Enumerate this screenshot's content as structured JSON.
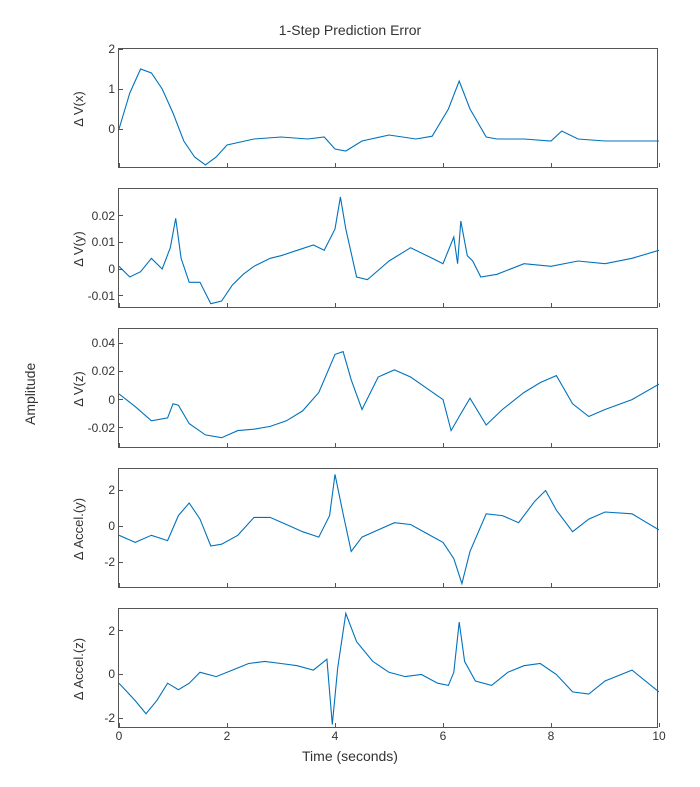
{
  "chart_data": [
    {
      "type": "line",
      "title": "1-Step Prediction Error",
      "xlabel": "",
      "ylabel": "Δ V(x)",
      "xlim": [
        0,
        10
      ],
      "ylim": [
        -1,
        2
      ],
      "yticks": [
        0,
        1,
        2
      ],
      "x": [
        0,
        0.2,
        0.4,
        0.6,
        0.8,
        1.0,
        1.2,
        1.4,
        1.6,
        1.8,
        2.0,
        2.5,
        3.0,
        3.5,
        3.8,
        4.0,
        4.2,
        4.5,
        5.0,
        5.5,
        5.8,
        6.1,
        6.3,
        6.5,
        6.8,
        7.0,
        7.5,
        8.0,
        8.2,
        8.5,
        9.0,
        9.5,
        10.0
      ],
      "values": [
        0.0,
        0.9,
        1.5,
        1.4,
        1.0,
        0.4,
        -0.3,
        -0.7,
        -0.9,
        -0.7,
        -0.4,
        -0.25,
        -0.2,
        -0.25,
        -0.2,
        -0.5,
        -0.55,
        -0.3,
        -0.15,
        -0.25,
        -0.18,
        0.5,
        1.2,
        0.5,
        -0.2,
        -0.25,
        -0.25,
        -0.3,
        -0.05,
        -0.25,
        -0.3,
        -0.3,
        -0.3
      ]
    },
    {
      "type": "line",
      "xlabel": "",
      "ylabel": "Δ V(y)",
      "xlim": [
        0,
        10
      ],
      "ylim": [
        -0.015,
        0.03
      ],
      "yticks": [
        -0.01,
        0,
        0.01,
        0.02
      ],
      "x": [
        0,
        0.2,
        0.4,
        0.6,
        0.8,
        0.95,
        1.05,
        1.15,
        1.3,
        1.5,
        1.7,
        1.9,
        2.1,
        2.3,
        2.5,
        2.8,
        3.0,
        3.3,
        3.6,
        3.8,
        4.0,
        4.1,
        4.2,
        4.4,
        4.6,
        5.0,
        5.4,
        5.8,
        6.0,
        6.2,
        6.27,
        6.33,
        6.45,
        6.55,
        6.7,
        7.0,
        7.5,
        8.0,
        8.5,
        9.0,
        9.5,
        10.0
      ],
      "values": [
        0.001,
        -0.003,
        -0.001,
        0.004,
        0.0,
        0.008,
        0.019,
        0.004,
        -0.005,
        -0.005,
        -0.013,
        -0.012,
        -0.006,
        -0.002,
        0.001,
        0.004,
        0.005,
        0.007,
        0.009,
        0.007,
        0.015,
        0.027,
        0.015,
        -0.003,
        -0.004,
        0.003,
        0.008,
        0.004,
        0.002,
        0.012,
        0.002,
        0.018,
        0.005,
        0.003,
        -0.003,
        -0.002,
        0.002,
        0.001,
        0.003,
        0.002,
        0.004,
        0.007
      ]
    },
    {
      "type": "line",
      "xlabel": "",
      "ylabel": "Δ V(z)",
      "xlim": [
        0,
        10
      ],
      "ylim": [
        -0.035,
        0.05
      ],
      "yticks": [
        -0.02,
        0,
        0.02,
        0.04
      ],
      "x": [
        0,
        0.3,
        0.6,
        0.9,
        1.0,
        1.1,
        1.3,
        1.6,
        1.9,
        2.2,
        2.5,
        2.8,
        3.1,
        3.4,
        3.7,
        4.0,
        4.15,
        4.3,
        4.5,
        4.8,
        5.1,
        5.4,
        5.7,
        6.0,
        6.15,
        6.3,
        6.5,
        6.8,
        7.1,
        7.5,
        7.8,
        8.1,
        8.4,
        8.7,
        9.0,
        9.5,
        10.0
      ],
      "values": [
        0.004,
        -0.005,
        -0.015,
        -0.013,
        -0.003,
        -0.004,
        -0.017,
        -0.025,
        -0.027,
        -0.022,
        -0.021,
        -0.019,
        -0.015,
        -0.008,
        0.005,
        0.032,
        0.034,
        0.014,
        -0.007,
        0.016,
        0.021,
        0.016,
        0.008,
        0.0,
        -0.022,
        -0.012,
        0.001,
        -0.018,
        -0.007,
        0.005,
        0.012,
        0.017,
        -0.003,
        -0.012,
        -0.007,
        0.0,
        0.011
      ]
    },
    {
      "type": "line",
      "xlabel": "",
      "ylabel": "Δ Accel.(y)",
      "xlim": [
        0,
        10
      ],
      "ylim": [
        -3.5,
        3.2
      ],
      "yticks": [
        -2,
        0,
        2
      ],
      "x": [
        0,
        0.3,
        0.6,
        0.9,
        1.1,
        1.3,
        1.5,
        1.7,
        1.9,
        2.2,
        2.5,
        2.8,
        3.1,
        3.4,
        3.7,
        3.9,
        4.0,
        4.15,
        4.3,
        4.5,
        4.8,
        5.1,
        5.4,
        5.7,
        6.0,
        6.2,
        6.35,
        6.5,
        6.8,
        7.1,
        7.4,
        7.7,
        7.9,
        8.1,
        8.4,
        8.7,
        9.0,
        9.5,
        10.0
      ],
      "values": [
        -0.5,
        -0.9,
        -0.5,
        -0.8,
        0.6,
        1.3,
        0.4,
        -1.1,
        -1.0,
        -0.5,
        0.5,
        0.5,
        0.1,
        -0.3,
        -0.6,
        0.6,
        2.9,
        0.7,
        -1.4,
        -0.6,
        -0.2,
        0.2,
        0.1,
        -0.4,
        -0.9,
        -1.8,
        -3.2,
        -1.4,
        0.7,
        0.6,
        0.2,
        1.4,
        2.0,
        0.9,
        -0.3,
        0.4,
        0.8,
        0.7,
        -0.2
      ]
    },
    {
      "type": "line",
      "xlabel": "Time (seconds)",
      "ylabel": "Δ Accel.(z)",
      "xlim": [
        0,
        10
      ],
      "ylim": [
        -2.5,
        3.0
      ],
      "yticks": [
        -2,
        0,
        2
      ],
      "xticks": [
        0,
        2,
        4,
        6,
        8,
        10
      ],
      "x": [
        0,
        0.3,
        0.5,
        0.7,
        0.9,
        1.1,
        1.3,
        1.5,
        1.8,
        2.1,
        2.4,
        2.7,
        3.0,
        3.3,
        3.6,
        3.85,
        3.95,
        4.05,
        4.2,
        4.4,
        4.7,
        5.0,
        5.3,
        5.6,
        5.9,
        6.1,
        6.2,
        6.3,
        6.4,
        6.6,
        6.9,
        7.2,
        7.5,
        7.8,
        8.1,
        8.4,
        8.7,
        9.0,
        9.5,
        10.0
      ],
      "values": [
        -0.4,
        -1.2,
        -1.8,
        -1.2,
        -0.4,
        -0.7,
        -0.4,
        0.1,
        -0.1,
        0.2,
        0.5,
        0.6,
        0.5,
        0.4,
        0.2,
        0.7,
        -2.3,
        0.3,
        2.8,
        1.5,
        0.6,
        0.1,
        -0.1,
        0.0,
        -0.4,
        -0.5,
        0.1,
        2.4,
        0.6,
        -0.3,
        -0.5,
        0.1,
        0.4,
        0.5,
        0.0,
        -0.8,
        -0.9,
        -0.3,
        0.2,
        -0.8
      ]
    }
  ],
  "layout": {
    "figure_title": "1-Step Prediction Error",
    "global_ylabel": "Amplitude",
    "global_xlabel": "Time (seconds)",
    "line_color": "#0072BD"
  }
}
